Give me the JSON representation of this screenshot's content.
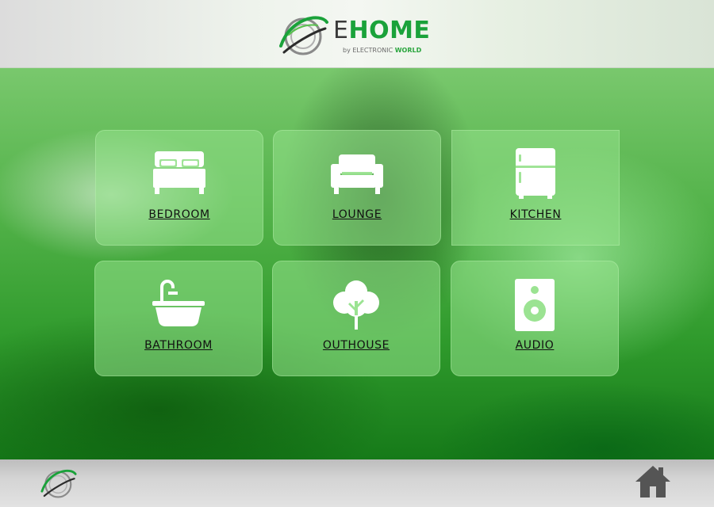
{
  "brand": {
    "prefix": "E",
    "name": "HOME",
    "tagline_prefix": "by ELECTRONIC ",
    "tagline_highlight": "WORLD",
    "logo_icon": "globe-swoosh-icon"
  },
  "rooms": [
    {
      "label": "BEDROOM",
      "icon": "bed-icon"
    },
    {
      "label": "LOUNGE",
      "icon": "sofa-icon"
    },
    {
      "label": "KITCHEN",
      "icon": "fridge-icon"
    },
    {
      "label": "BATHROOM",
      "icon": "bathtub-icon"
    },
    {
      "label": "OUTHOUSE",
      "icon": "tree-icon"
    },
    {
      "label": "AUDIO",
      "icon": "speaker-icon"
    }
  ],
  "footer": {
    "logo_icon": "globe-swoosh-icon",
    "home_icon": "home-icon"
  },
  "colors": {
    "accent": "#1aa23a",
    "tile": "#96e18c",
    "icon": "#ffffff"
  }
}
